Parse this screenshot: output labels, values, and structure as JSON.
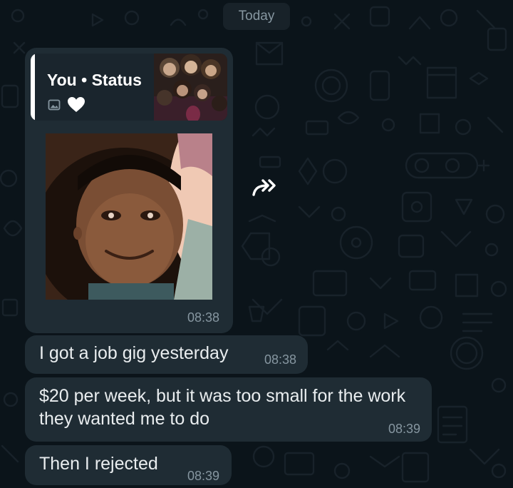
{
  "chat": {
    "date_divider": "Today",
    "status_reply": {
      "quote_title": "You • Status",
      "quote_icons": [
        "image-icon",
        "heart-icon"
      ],
      "time": "08:38"
    },
    "forward_icon": "forward-arrow-icon",
    "messages": [
      {
        "text": "I got a job gig yesterday",
        "time": "08:38"
      },
      {
        "text": "$20 per week, but it was too small for the work they wanted me to do",
        "time": "08:39"
      },
      {
        "text": "Then I rejected",
        "time": "08:39"
      }
    ]
  },
  "colors": {
    "background": "#0b141a",
    "bubble": "#1f2c34",
    "quote_background": "#1a252d",
    "text": "#e9edef",
    "meta_text": "#8696a0"
  }
}
